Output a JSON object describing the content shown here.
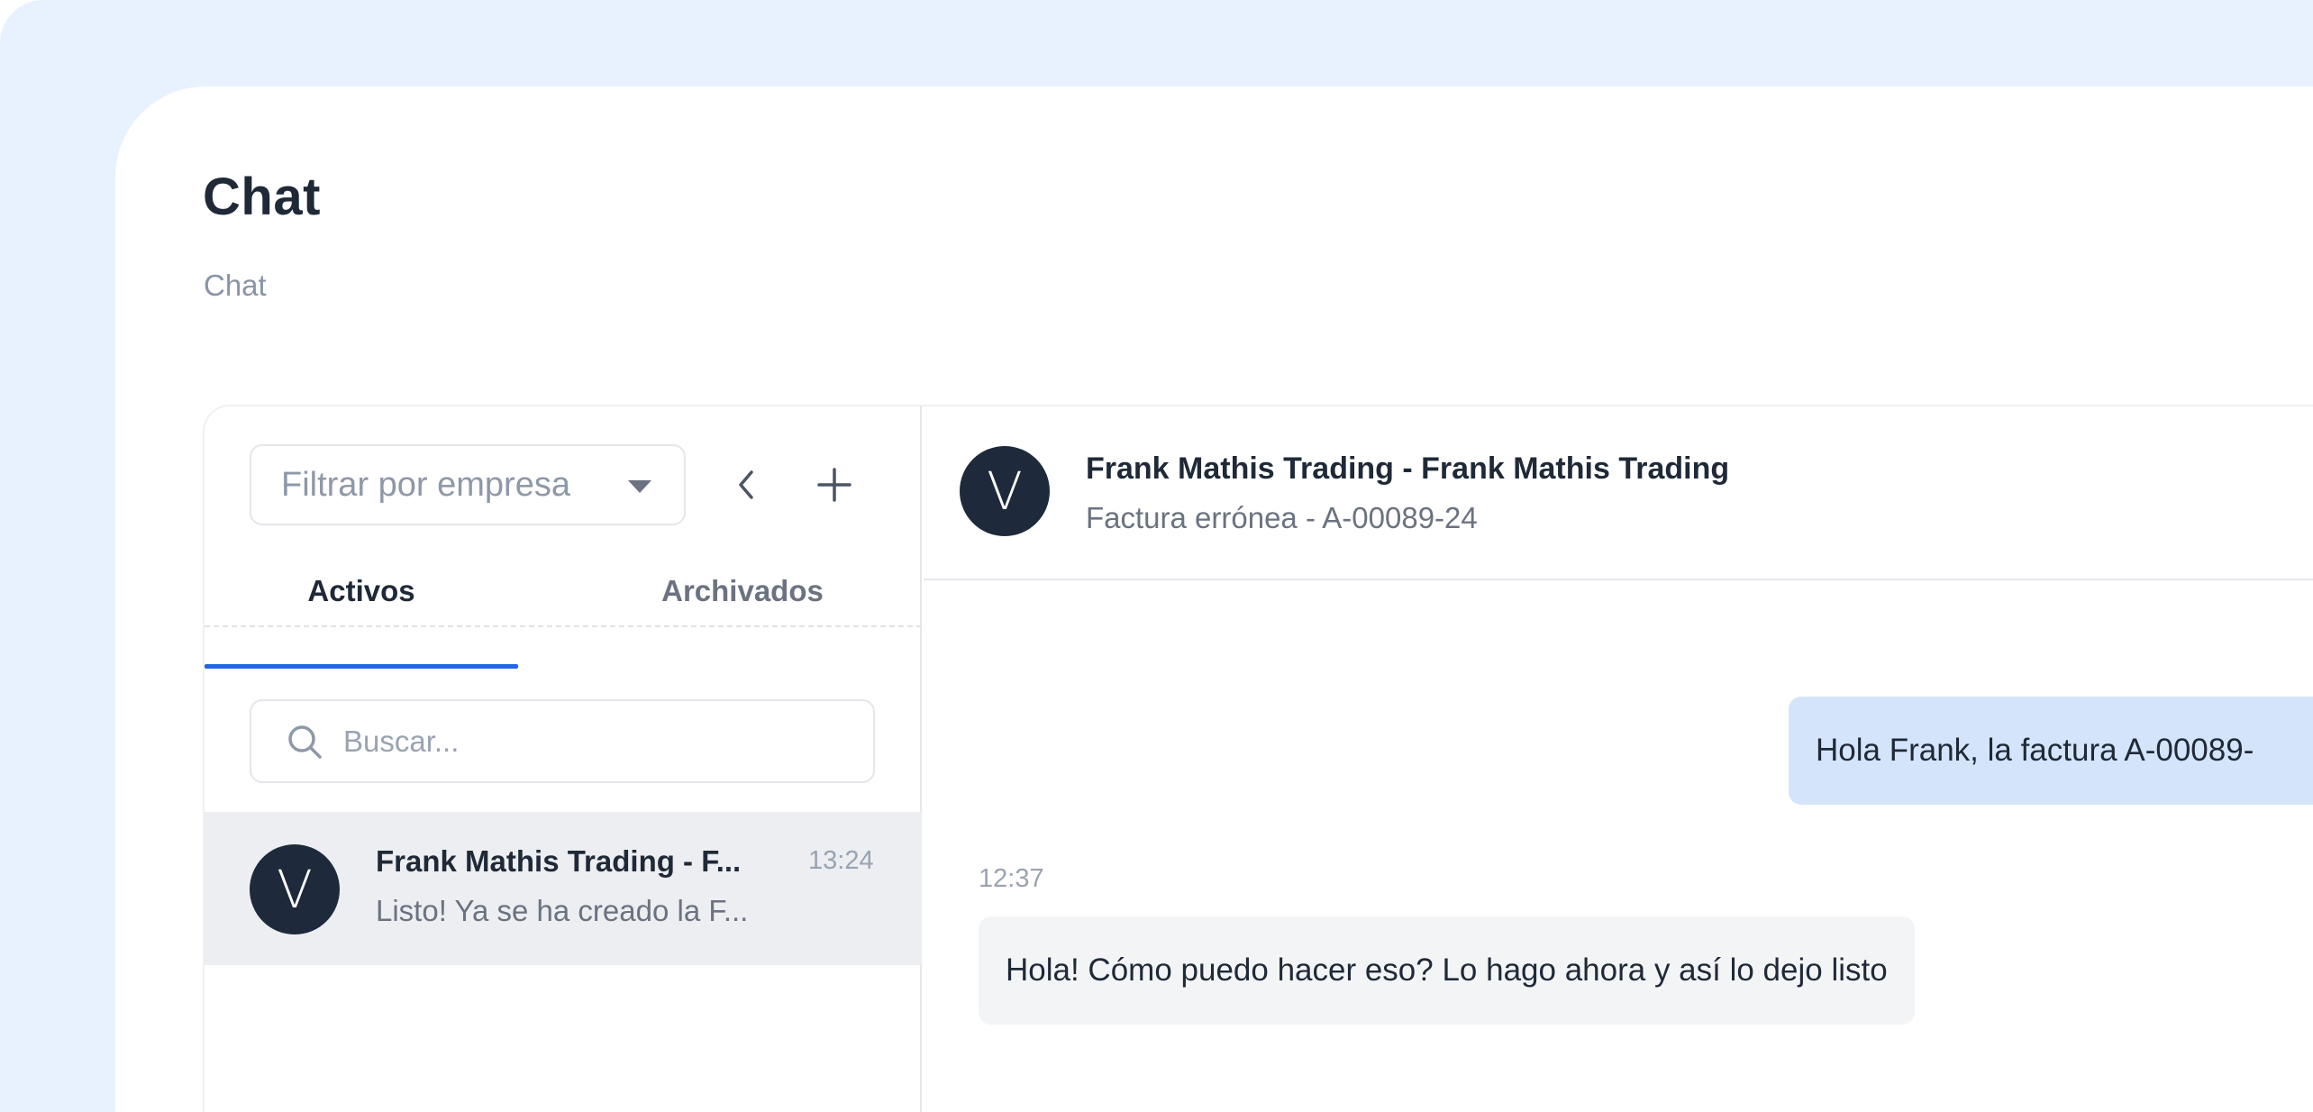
{
  "page": {
    "title": "Chat",
    "breadcrumb": "Chat"
  },
  "sidebar": {
    "filter": {
      "placeholder": "Filtrar por empresa",
      "icon": "caret-down-icon"
    },
    "back_icon": "chevron-left-icon",
    "add_icon": "plus-icon",
    "tabs": [
      {
        "label": "Activos",
        "active": true
      },
      {
        "label": "Archivados",
        "active": false
      }
    ],
    "search": {
      "placeholder": "Buscar...",
      "icon": "search-icon"
    },
    "conversations": [
      {
        "avatar_letter": "V",
        "name": "Frank Mathis Trading - F...",
        "preview": "Listo! Ya se ha creado la F...",
        "time": "13:24",
        "selected": true
      }
    ]
  },
  "conversation": {
    "avatar_letter": "V",
    "title": "Frank Mathis Trading - Frank Mathis Trading",
    "subtitle": "Factura errónea - A-00089-24",
    "messages": [
      {
        "direction": "outgoing",
        "text": "Hola Frank, la factura A-00089-"
      },
      {
        "direction": "incoming",
        "time": "12:37",
        "text": "Hola! Cómo puedo hacer eso? Lo hago ahora y así lo dejo listo"
      }
    ]
  },
  "colors": {
    "background": "#e8f1fe",
    "accent": "#2563eb",
    "avatar": "#1e2a3b",
    "outgoing_bubble": "#d4e4fb",
    "incoming_bubble": "#f3f4f6",
    "selected_row": "#eceef1"
  }
}
